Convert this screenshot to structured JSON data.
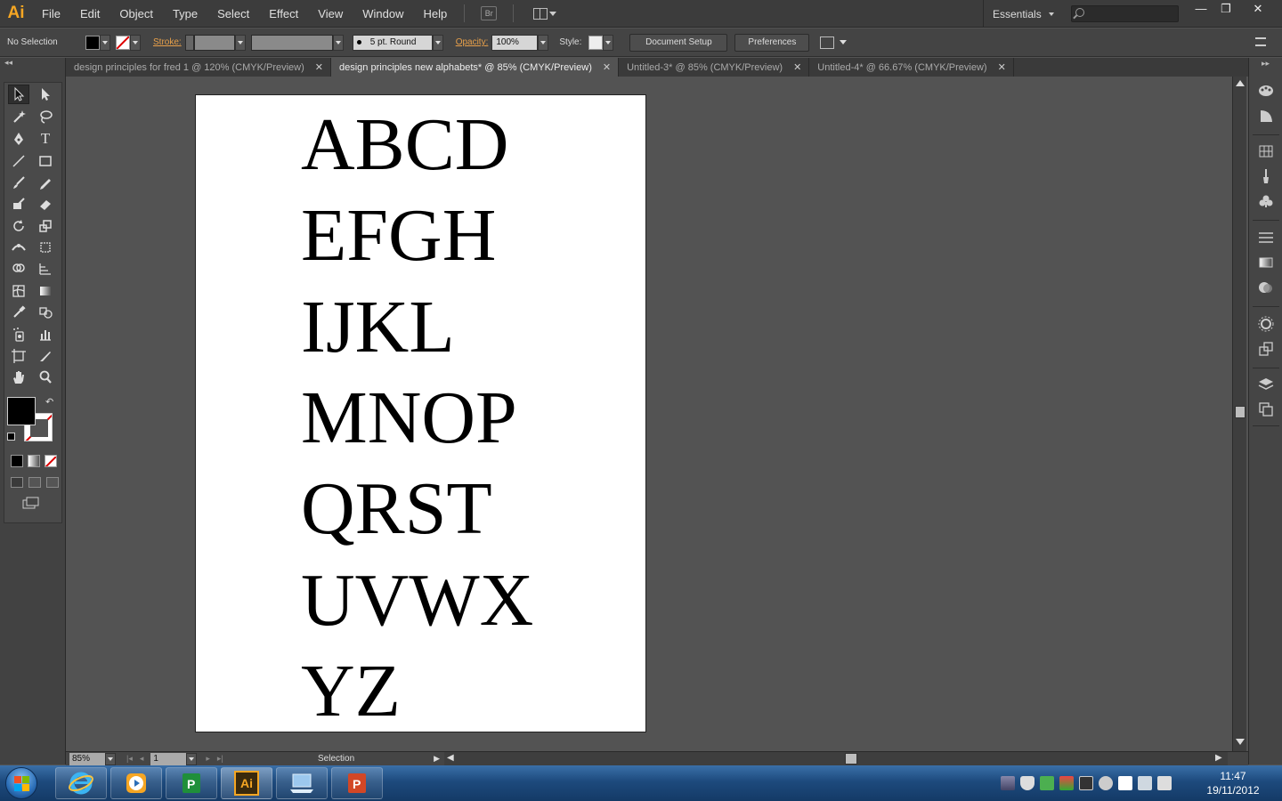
{
  "app": {
    "logo": "Ai"
  },
  "menubar": {
    "items": [
      "File",
      "Edit",
      "Object",
      "Type",
      "Select",
      "Effect",
      "View",
      "Window",
      "Help"
    ],
    "bridge": "Br",
    "workspace": "Essentials"
  },
  "window_controls": {
    "minimize": "—",
    "restore": "❐",
    "close": "✕"
  },
  "controlbar": {
    "selection": "No Selection",
    "stroke_label": "Stroke:",
    "brush": "5 pt. Round",
    "opacity_label": "Opacity:",
    "opacity_value": "100%",
    "style_label": "Style:",
    "document_setup": "Document Setup",
    "preferences": "Preferences"
  },
  "tabs": [
    {
      "label": "design principles for fred 1 @ 120% (CMYK/Preview)",
      "close": "✕"
    },
    {
      "label": "design principles new alphabets* @ 85% (CMYK/Preview)",
      "close": "✕"
    },
    {
      "label": "Untitled-3* @ 85% (CMYK/Preview)",
      "close": "✕"
    },
    {
      "label": "Untitled-4* @ 66.67% (CMYK/Preview)",
      "close": "✕"
    }
  ],
  "artboard": {
    "lines": [
      "ABCD",
      "EFGH",
      "IJKL",
      "MNOP",
      "QRST",
      "UVWX",
      "YZ"
    ]
  },
  "statusbar": {
    "zoom": "85%",
    "page": "1",
    "tool": "Selection"
  },
  "taskbar": {
    "apps": [
      "internet-explorer",
      "media-player",
      "publisher",
      "illustrator",
      "laptop-app",
      "powerpoint"
    ],
    "illustrator_label": "Ai",
    "time": "11:47",
    "date": "19/11/2012"
  },
  "colors": {
    "accent": "#f5a623",
    "canvas": "#535353",
    "fill": "#000000"
  }
}
